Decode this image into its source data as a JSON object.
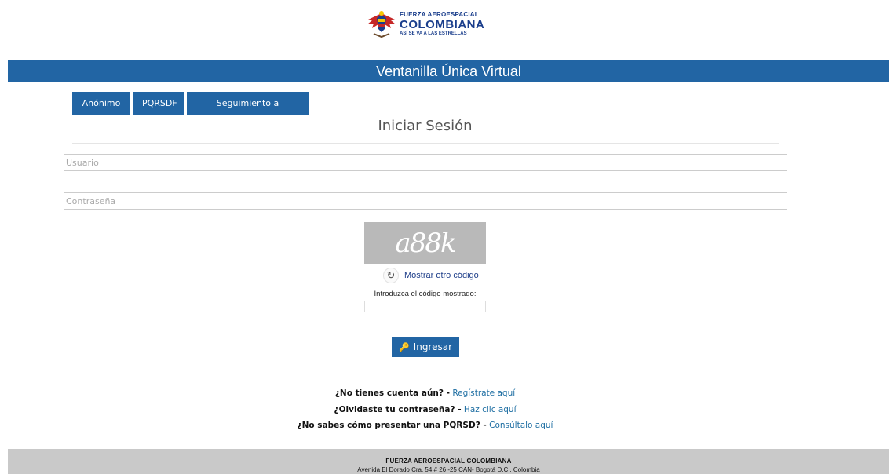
{
  "header": {
    "logo_line1": "FUERZA AEROESPACIAL",
    "logo_line2": "COLOMBIANA",
    "logo_line3": "ASÍ SE VA A LAS ESTRELLAS",
    "logo_icon": "eagle-emblem-icon"
  },
  "banner": {
    "title": "Ventanilla Única Virtual"
  },
  "tabs": [
    {
      "label": "Anónimo"
    },
    {
      "label": "PQRSDF"
    },
    {
      "label": "Seguimiento a solicitudes"
    }
  ],
  "login": {
    "title": "Iniciar Sesión",
    "username_placeholder": "Usuario",
    "password_placeholder": "Contraseña",
    "captcha_text": "a88k",
    "refresh_icon": "refresh-icon",
    "refresh_label": "Mostrar otro código",
    "code_label": "Introduzca el código mostrado:",
    "submit_label": "Ingresar",
    "submit_icon": "key-icon"
  },
  "help_links": [
    {
      "question": "¿No tienes cuenta aún? -",
      "link": "Regístrate aquí"
    },
    {
      "question": "¿Olvidaste tu contraseña? -",
      "link": "Haz clic aquí"
    },
    {
      "question": "¿No sabes cómo presentar una PQRSD? -",
      "link": "Consúltalo aquí"
    }
  ],
  "footer": {
    "line1": "FUERZA AEROESPACIAL COLOMBIANA",
    "line2": "Avenida El Dorado Cra. 54 # 26 -25 CAN- Bogotá D.C., Colombia"
  },
  "colors": {
    "primary": "#2265a4",
    "link": "#1f6fa3",
    "footer_bg": "#c9c9c9"
  }
}
